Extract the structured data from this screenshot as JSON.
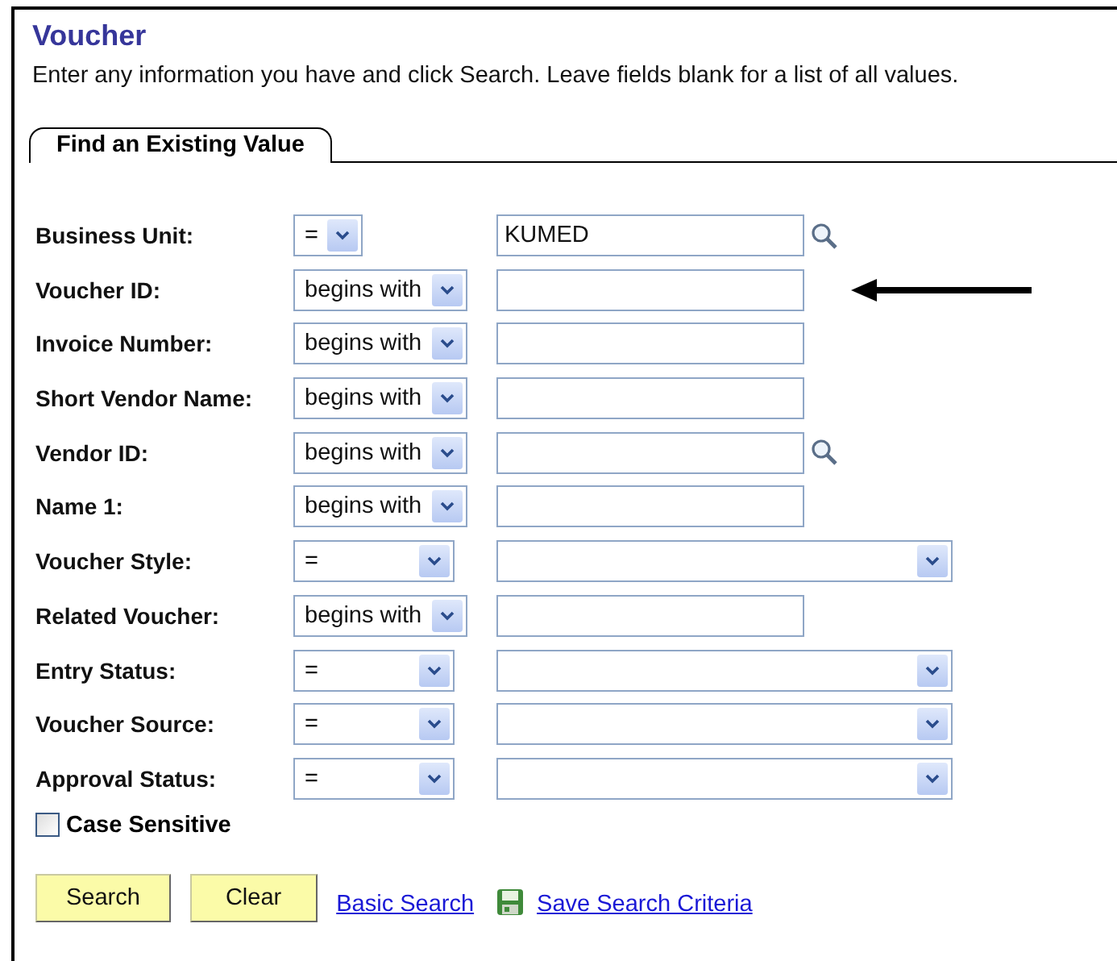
{
  "title": "Voucher",
  "instructions": "Enter any information you have and click Search. Leave fields blank for a list of all values.",
  "tabs": [
    {
      "label": "Find an Existing Value",
      "selected": true
    }
  ],
  "fields": [
    {
      "label": "Business Unit:",
      "operator": "=",
      "kind": "text",
      "value": "KUMED",
      "lookup": true
    },
    {
      "label": "Voucher ID:",
      "operator": "begins with",
      "kind": "text",
      "pointer": true
    },
    {
      "label": "Invoice Number:",
      "operator": "begins with",
      "kind": "text"
    },
    {
      "label": "Short Vendor Name:",
      "operator": "begins with",
      "kind": "text"
    },
    {
      "label": "Vendor ID:",
      "operator": "begins with",
      "kind": "text",
      "lookup": true
    },
    {
      "label": "Name 1:",
      "operator": "begins with",
      "kind": "text"
    },
    {
      "label": "Voucher Style:",
      "operator": "=",
      "kind": "dropdown"
    },
    {
      "label": "Related Voucher:",
      "operator": "begins with",
      "kind": "text"
    },
    {
      "label": "Entry Status:",
      "operator": "=",
      "kind": "dropdown"
    },
    {
      "label": "Voucher Source:",
      "operator": "=",
      "kind": "dropdown"
    },
    {
      "label": "Approval Status:",
      "operator": "=",
      "kind": "dropdown"
    }
  ],
  "case_sensitive": {
    "label": "Case Sensitive",
    "checked": false
  },
  "buttons": [
    "Search",
    "Clear"
  ],
  "links": [
    {
      "label": "Basic Search",
      "icon": false
    },
    {
      "label": "Save Search Criteria",
      "icon": true
    }
  ]
}
